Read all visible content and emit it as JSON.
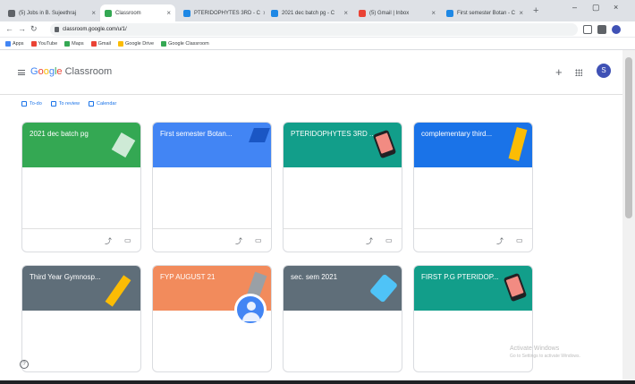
{
  "browser": {
    "tabs": [
      {
        "label": "(5) Jobs in B. Sujeethraj",
        "color": "#5f6368",
        "active": false
      },
      {
        "label": "Classroom",
        "color": "#34a853",
        "active": true
      },
      {
        "label": "PTERIDOPHYTES 3RD - C",
        "color": "#1e88e5",
        "active": false
      },
      {
        "label": "2021 dec batch pg - C",
        "color": "#1e88e5",
        "active": false
      },
      {
        "label": "(5) Gmail | Inbox",
        "color": "#ea4335",
        "active": false
      },
      {
        "label": "First semester Botan - C",
        "color": "#1e88e5",
        "active": false
      }
    ],
    "url": "classroom.google.com/u/1/",
    "bookmarks": [
      {
        "label": "Apps",
        "color": "#4285f4"
      },
      {
        "label": "YouTube",
        "color": "#ea4335"
      },
      {
        "label": "Maps",
        "color": "#34a853"
      },
      {
        "label": "Gmail",
        "color": "#ea4335"
      },
      {
        "label": "Google Drive",
        "color": "#fbbc05"
      },
      {
        "label": "Google Classroom",
        "color": "#34a853"
      }
    ]
  },
  "header": {
    "logo_google": [
      "G",
      "o",
      "o",
      "g",
      "l",
      "e"
    ],
    "logo_product": "Classroom",
    "avatar_letter": "S"
  },
  "subnav": [
    {
      "label": "To-do"
    },
    {
      "label": "To review"
    },
    {
      "label": "Calendar"
    }
  ],
  "classes": [
    {
      "title": "2021 dec batch pg",
      "subtitle": "",
      "color": "#34a853"
    },
    {
      "title": "First semester Botan...",
      "subtitle": "",
      "color": "#4285f4"
    },
    {
      "title": "PTERIDOPHYTES 3RD ...",
      "subtitle": "",
      "color": "#129e8a"
    },
    {
      "title": "complementary third...",
      "subtitle": "",
      "color": "#1a73e8"
    },
    {
      "title": "Third Year Gymnosp...",
      "subtitle": "",
      "color": "#5f6e79"
    },
    {
      "title": "FYP AUGUST 21",
      "subtitle": "",
      "color": "#f28b5c"
    },
    {
      "title": "sec. sem 2021",
      "subtitle": "",
      "color": "#5f6e79"
    },
    {
      "title": "FIRST P.G PTERIDOP...",
      "subtitle": "",
      "color": "#129e8a"
    }
  ],
  "watermark": {
    "line1": "Activate Windows",
    "line2": "Go to Settings to activate Windows."
  },
  "help_label": "?"
}
